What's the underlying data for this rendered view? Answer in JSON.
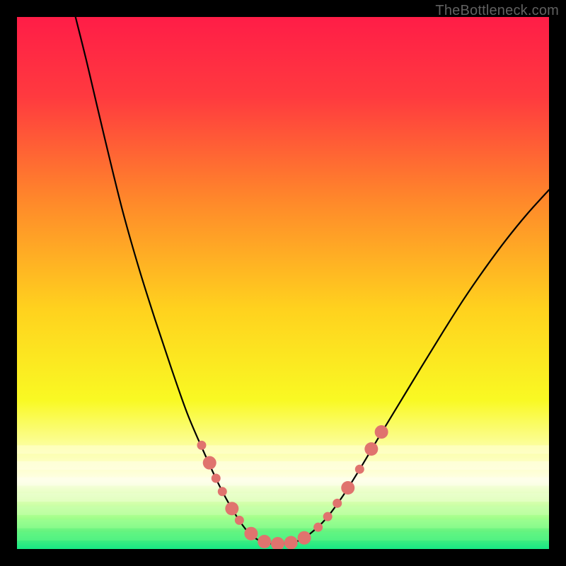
{
  "watermark": "TheBottleneck.com",
  "chart_data": {
    "type": "line",
    "title": "",
    "xlabel": "",
    "ylabel": "",
    "xlim": [
      0,
      100
    ],
    "ylim": [
      0,
      100
    ],
    "grid": false,
    "legend": false,
    "background": {
      "type": "vertical-gradient",
      "stops": [
        {
          "offset": 0.0,
          "color": "#ff1d47"
        },
        {
          "offset": 0.15,
          "color": "#ff3a3f"
        },
        {
          "offset": 0.35,
          "color": "#ff8a2a"
        },
        {
          "offset": 0.55,
          "color": "#ffd21e"
        },
        {
          "offset": 0.72,
          "color": "#f9f923"
        },
        {
          "offset": 0.82,
          "color": "#fcffb0"
        },
        {
          "offset": 0.87,
          "color": "#ffffe6"
        },
        {
          "offset": 0.91,
          "color": "#d9ffb0"
        },
        {
          "offset": 0.94,
          "color": "#a6ff8c"
        },
        {
          "offset": 0.97,
          "color": "#5df27e"
        },
        {
          "offset": 1.0,
          "color": "#17e884"
        }
      ]
    },
    "series": [
      {
        "name": "curve",
        "stroke": "#000000",
        "stroke_width": 2.2,
        "points": [
          {
            "x": 11.0,
            "y": 100.0
          },
          {
            "x": 13.0,
            "y": 92.0
          },
          {
            "x": 15.0,
            "y": 83.5
          },
          {
            "x": 17.5,
            "y": 73.0
          },
          {
            "x": 20.0,
            "y": 63.0
          },
          {
            "x": 23.0,
            "y": 52.5
          },
          {
            "x": 26.0,
            "y": 43.0
          },
          {
            "x": 29.0,
            "y": 34.0
          },
          {
            "x": 32.0,
            "y": 25.5
          },
          {
            "x": 35.0,
            "y": 18.5
          },
          {
            "x": 38.0,
            "y": 12.0
          },
          {
            "x": 40.5,
            "y": 7.4
          },
          {
            "x": 43.0,
            "y": 3.7
          },
          {
            "x": 45.0,
            "y": 1.9
          },
          {
            "x": 47.0,
            "y": 1.1
          },
          {
            "x": 49.0,
            "y": 1.0
          },
          {
            "x": 51.0,
            "y": 1.1
          },
          {
            "x": 53.0,
            "y": 1.6
          },
          {
            "x": 55.0,
            "y": 2.8
          },
          {
            "x": 58.0,
            "y": 5.6
          },
          {
            "x": 61.0,
            "y": 9.6
          },
          {
            "x": 64.0,
            "y": 14.3
          },
          {
            "x": 68.0,
            "y": 21.0
          },
          {
            "x": 72.0,
            "y": 27.6
          },
          {
            "x": 76.0,
            "y": 34.2
          },
          {
            "x": 80.0,
            "y": 40.7
          },
          {
            "x": 84.0,
            "y": 47.0
          },
          {
            "x": 88.0,
            "y": 52.8
          },
          {
            "x": 92.0,
            "y": 58.2
          },
          {
            "x": 96.0,
            "y": 63.1
          },
          {
            "x": 100.0,
            "y": 67.5
          }
        ]
      },
      {
        "name": "dot-chain",
        "type": "scatter",
        "fill": "#e0736e",
        "stroke": "#d35a55",
        "r_small": 6.5,
        "r_big": 9.5,
        "points": [
          {
            "x": 34.7,
            "y": 19.5,
            "r": "small"
          },
          {
            "x": 36.2,
            "y": 16.2,
            "r": "big"
          },
          {
            "x": 37.4,
            "y": 13.3,
            "r": "small"
          },
          {
            "x": 38.6,
            "y": 10.8,
            "r": "small"
          },
          {
            "x": 40.4,
            "y": 7.6,
            "r": "big"
          },
          {
            "x": 41.8,
            "y": 5.4,
            "r": "small"
          },
          {
            "x": 44.0,
            "y": 2.9,
            "r": "big"
          },
          {
            "x": 46.5,
            "y": 1.4,
            "r": "big"
          },
          {
            "x": 49.0,
            "y": 1.0,
            "r": "big"
          },
          {
            "x": 51.5,
            "y": 1.2,
            "r": "big"
          },
          {
            "x": 54.0,
            "y": 2.1,
            "r": "big"
          },
          {
            "x": 56.6,
            "y": 4.1,
            "r": "small"
          },
          {
            "x": 58.4,
            "y": 6.1,
            "r": "small"
          },
          {
            "x": 60.2,
            "y": 8.6,
            "r": "small"
          },
          {
            "x": 62.2,
            "y": 11.5,
            "r": "big"
          },
          {
            "x": 64.4,
            "y": 15.0,
            "r": "small"
          },
          {
            "x": 66.6,
            "y": 18.8,
            "r": "big"
          },
          {
            "x": 68.5,
            "y": 22.0,
            "r": "big"
          }
        ]
      }
    ]
  }
}
